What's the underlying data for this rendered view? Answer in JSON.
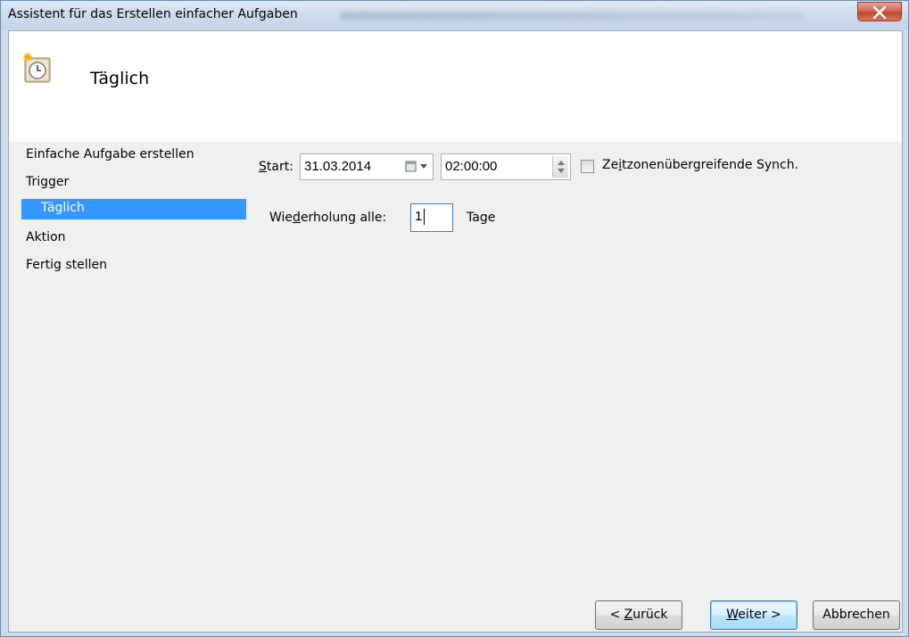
{
  "window": {
    "title": "Assistent für das Erstellen einfacher Aufgaben"
  },
  "header": {
    "icon": "scheduled-task-clock-icon",
    "title": "Täglich"
  },
  "nav": {
    "items": [
      {
        "label": "Einfache Aufgabe erstellen",
        "selected": false
      },
      {
        "label": "Trigger",
        "selected": false
      },
      {
        "label": "Täglich",
        "selected": true
      },
      {
        "label": "Aktion",
        "selected": false
      },
      {
        "label": "Fertig stellen",
        "selected": false
      }
    ]
  },
  "form": {
    "start_label_accel": "S",
    "start_label_rest": "tart:",
    "start_date": "31.03.2014",
    "start_time": "02:00:00",
    "sync_checked": false,
    "sync_label_pre": "Ze",
    "sync_label_accel": "i",
    "sync_label_post": "tzonenübergreifende Synch.",
    "repeat_label_pre": "Wie",
    "repeat_label_accel": "d",
    "repeat_label_post": "erholung alle:",
    "repeat_value": "1",
    "repeat_unit": "Tage"
  },
  "buttons": {
    "back_pre": "< ",
    "back_accel": "Z",
    "back_post": "urück",
    "next_accel": "W",
    "next_post": "eiter >",
    "cancel": "Abbrechen"
  },
  "colors": {
    "selection": "#3399ff",
    "client_bg": "#f0f0f0",
    "titlebar": "#cfdcec"
  }
}
